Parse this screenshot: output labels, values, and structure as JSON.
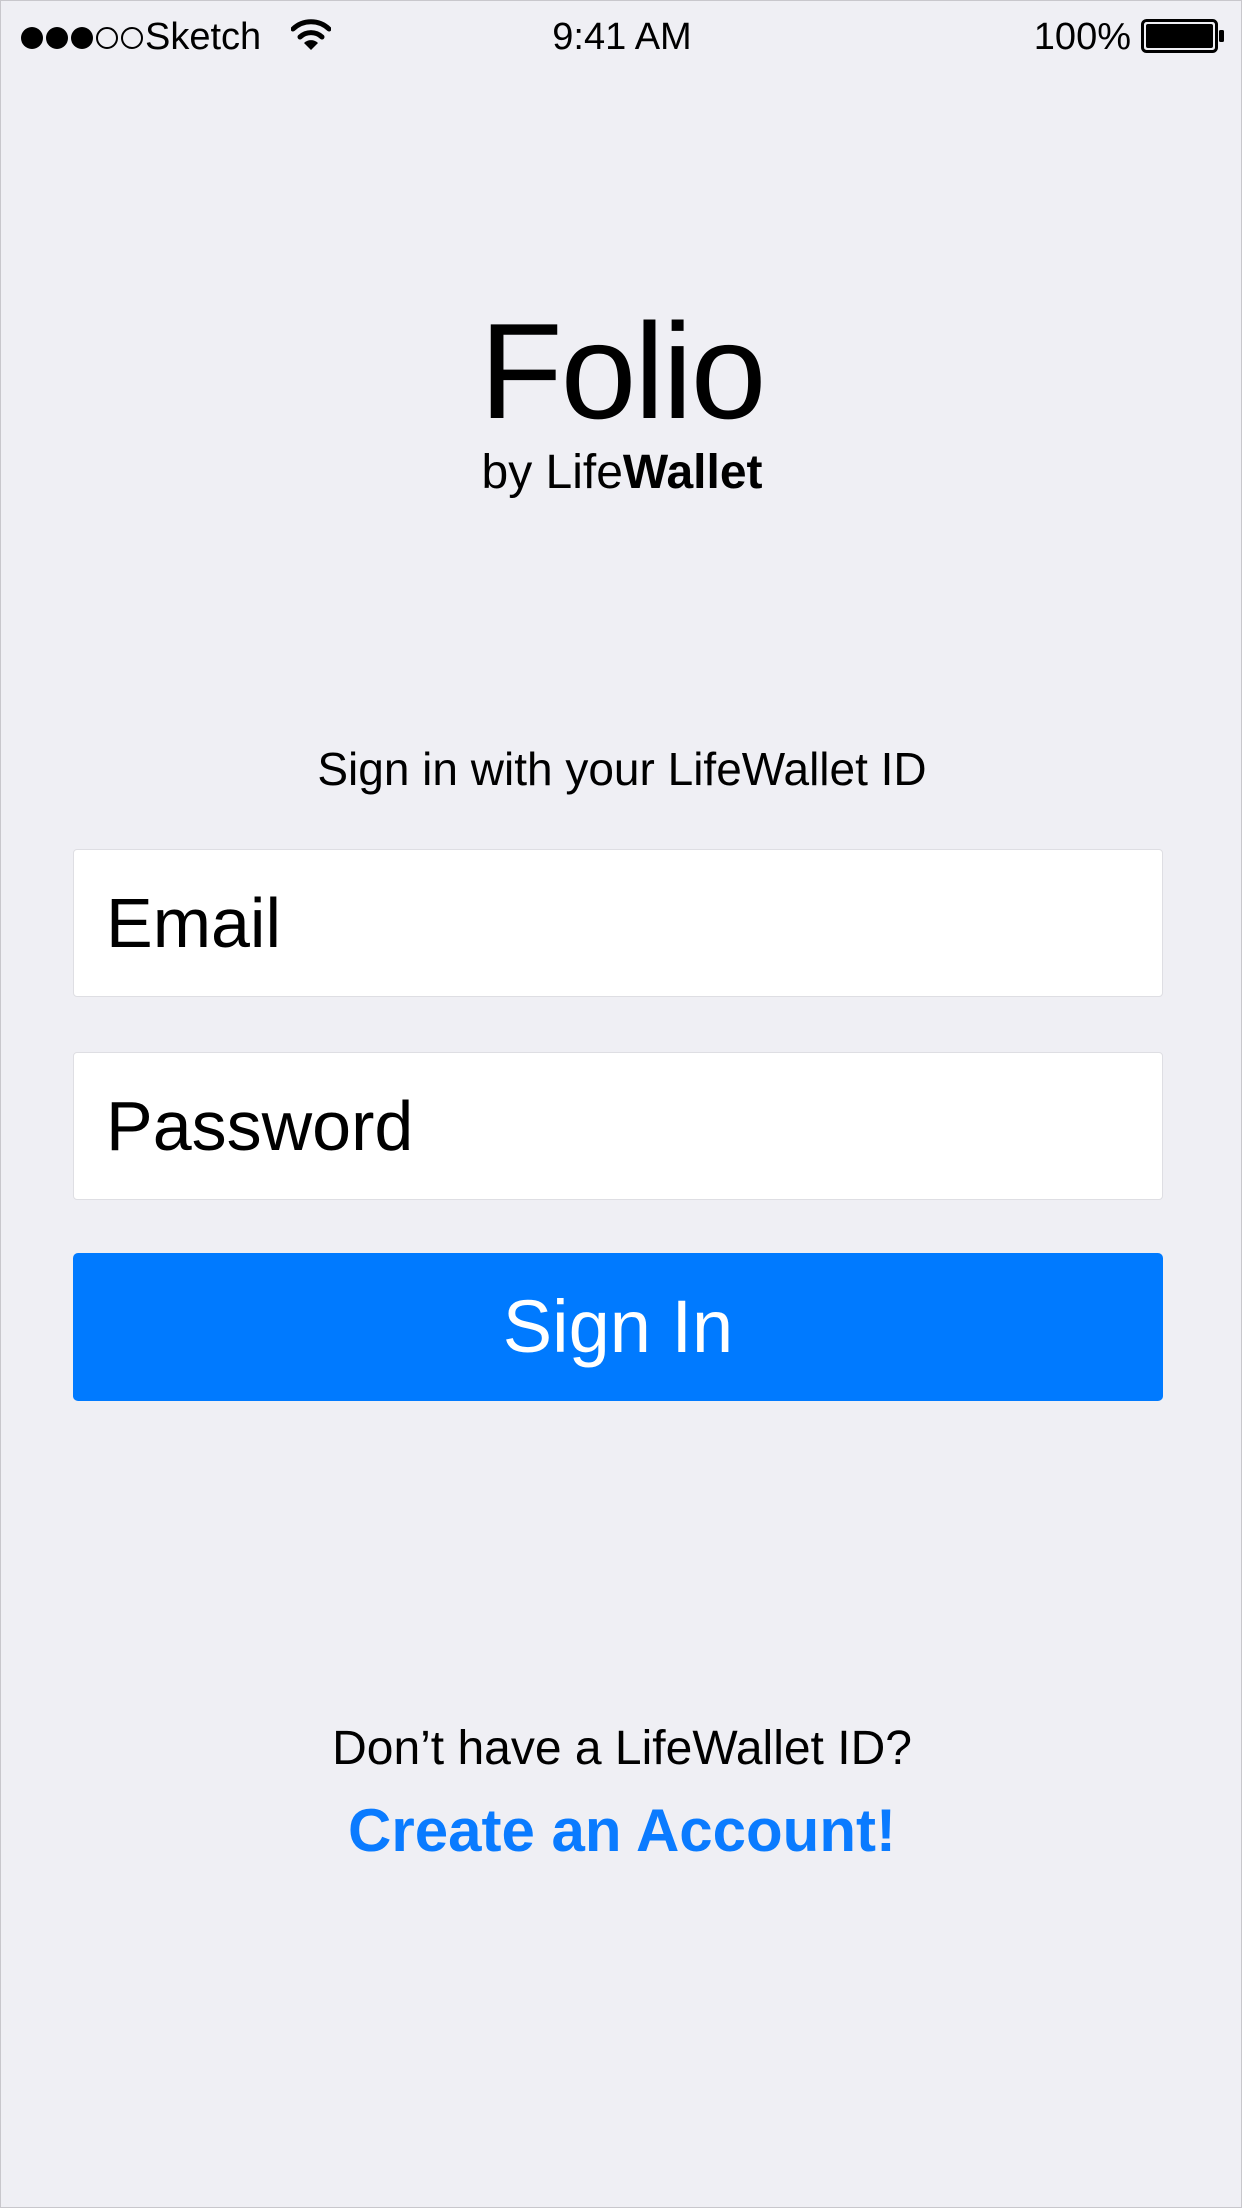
{
  "status_bar": {
    "carrier": "Sketch",
    "time": "9:41 AM",
    "battery": "100%",
    "signal_bars_filled": 3,
    "signal_bars_total": 5,
    "wifi_icon": "wifi-icon",
    "battery_icon": "battery-full-icon"
  },
  "logo": {
    "title": "Folio",
    "sub_prefix": "by Life",
    "sub_bold": "Wallet"
  },
  "sign_in": {
    "prompt": "Sign in with your LifeWallet ID",
    "email_placeholder": "Email",
    "password_placeholder": "Password",
    "button_label": "Sign In"
  },
  "footer": {
    "question": "Don’t have a LifeWallet ID?",
    "create_link": "Create an Account!"
  },
  "colors": {
    "background": "#efeff4",
    "accent": "#007aff",
    "link": "#0a7bff"
  }
}
